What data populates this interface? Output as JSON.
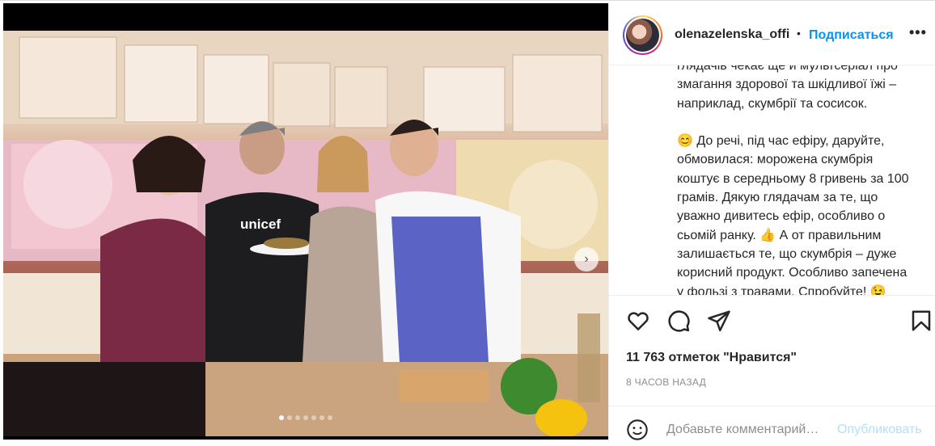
{
  "post": {
    "username": "olenazelenska_offi",
    "separator": "•",
    "follow_label": "Подписаться",
    "more_label": "•••",
    "caption": "глядачів чекає ще й мультсеріал про\nзмагання здорової та шкідливої їжі –\nнаприклад, скумбрії та сосисок.\n\n😊 До речі, під час ефіру, даруйте,\nобмовилася: морожена скумбрія\nкоштує в середньому 8 гривень за 100\nграмів. Дякую глядачам за те, що\nуважно дивитесь ефір, особливо о\nсьомій ранку. 👍 А от правильним\nзалишається те, що скумбрія – дуже\nкорисний продукт. Особливо запечена\nу фользі з травами. Спробуйте! 😉",
    "likes": "11 763 отметок \"Нравится\"",
    "time": "8 ЧАСОВ НАЗАД",
    "comment_placeholder": "Добавьте комментарий…",
    "publish_label": "Опубликовать",
    "photo_logo": "unicef"
  },
  "carousel": {
    "total": 7,
    "active_index": 0
  },
  "icons": {
    "like": "heart-icon",
    "comment": "comment-icon",
    "share": "share-icon",
    "save": "bookmark-icon",
    "emoji": "smiley-icon",
    "next": "chevron-right-icon"
  },
  "colors": {
    "link": "#0095f6",
    "publish_disabled": "#b2dffc",
    "muted": "#8e8e8e",
    "text": "#262626"
  }
}
